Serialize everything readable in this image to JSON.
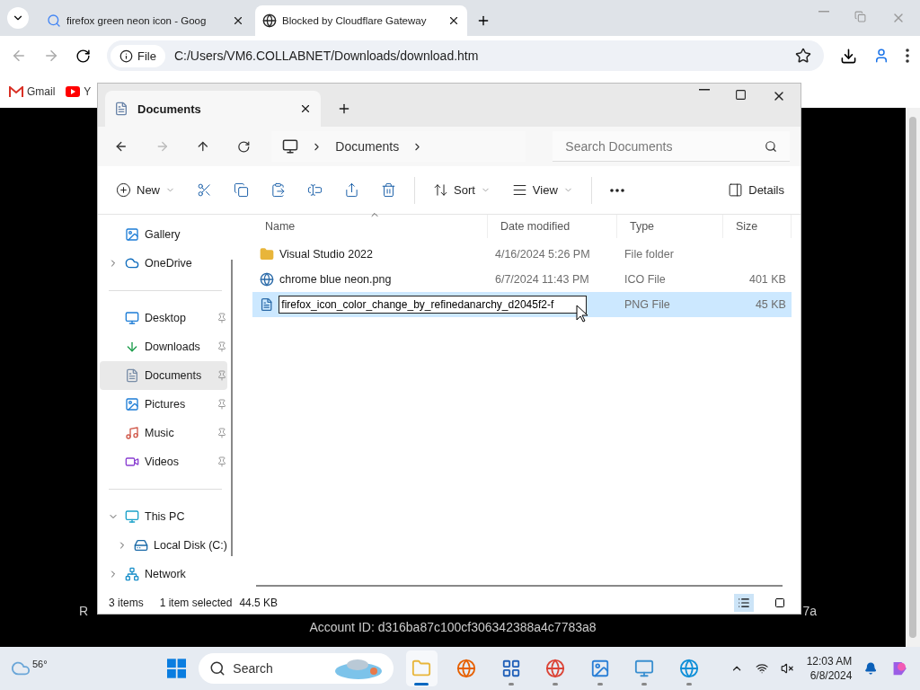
{
  "browser": {
    "tabs": [
      {
        "title": "firefox green neon icon - Goog",
        "selected": false
      },
      {
        "title": "Blocked by Cloudflare Gateway",
        "selected": true
      }
    ],
    "address": {
      "chip": "File",
      "url": "C:/Users/VM6.COLLABNET/Downloads/download.htm"
    },
    "bookmarks": [
      {
        "label": "Gmail"
      },
      {
        "label": "Y"
      }
    ]
  },
  "page": {
    "line_start": "R",
    "line_end": "7a",
    "account_id": "Account ID: d316ba87c100cf306342388a4c7783a8"
  },
  "explorer": {
    "tabs": [
      {
        "title": "Documents",
        "selected": true
      }
    ],
    "breadcrumb": [
      "Documents"
    ],
    "search": {
      "placeholder": "Search Documents"
    },
    "commands": [
      {
        "kind": "menu",
        "label": "New"
      },
      {
        "kind": "icon"
      },
      {
        "kind": "icon"
      },
      {
        "kind": "icon"
      },
      {
        "kind": "icon"
      },
      {
        "kind": "icon"
      },
      {
        "kind": "icon"
      },
      {
        "kind": "separator"
      },
      {
        "kind": "menu",
        "label": "Sort"
      },
      {
        "kind": "menu",
        "label": "View"
      },
      {
        "kind": "separator"
      },
      {
        "kind": "more"
      },
      {
        "kind": "spacer"
      },
      {
        "kind": "plain",
        "label": "Details"
      }
    ],
    "sidebar": [
      [
        {
          "label": "Gallery",
          "selected": false
        },
        {
          "label": "OneDrive",
          "selected": false,
          "expanded": false
        }
      ],
      [
        {
          "label": "Desktop",
          "selected": false,
          "pinned": true
        },
        {
          "label": "Downloads",
          "selected": false,
          "pinned": true
        },
        {
          "label": "Documents",
          "selected": true,
          "pinned": true
        },
        {
          "label": "Pictures",
          "selected": false,
          "pinned": true
        },
        {
          "label": "Music",
          "selected": false,
          "pinned": true
        },
        {
          "label": "Videos",
          "selected": false,
          "pinned": true
        }
      ],
      [
        {
          "label": "This PC",
          "selected": false,
          "expanded": true,
          "children": [
            {
              "label": "Local Disk (C:)",
              "selected": false,
              "expanded": false
            }
          ]
        },
        {
          "label": "Network",
          "selected": false,
          "expanded": false
        }
      ]
    ],
    "columns": [
      {
        "label": "Name",
        "sorted": true
      },
      {
        "label": "Date modified",
        "sorted": false
      },
      {
        "label": "Type",
        "sorted": false
      },
      {
        "label": "Size",
        "sorted": false
      }
    ],
    "rows": [
      {
        "name": "Visual Studio 2022",
        "date": "4/16/2024 5:26 PM",
        "type": "File folder",
        "selected": false,
        "editing": false
      },
      {
        "name": "chrome blue neon.png",
        "date": "6/7/2024 11:43 PM",
        "type": "ICO File",
        "size": "401 KB",
        "selected": false,
        "editing": false
      },
      {
        "name": "firefox_icon_color_change_by_refinedanarchy_d2045f2-f",
        "type": "PNG File",
        "size": "45 KB",
        "selected": true,
        "editing": true
      }
    ],
    "status": {
      "count": "3 items",
      "selection": "1 item selected",
      "size": "44.5 KB",
      "views": [
        {
          "selected": true
        },
        {
          "selected": false
        }
      ]
    }
  },
  "taskbar": {
    "weather": "56°",
    "search": "Search",
    "apps": [
      {
        "running": true,
        "active": true
      },
      {
        "running": false,
        "active": false
      },
      {
        "running": true,
        "active": false
      },
      {
        "running": true,
        "active": false
      },
      {
        "running": true,
        "active": false
      },
      {
        "running": true,
        "active": false
      },
      {
        "running": true,
        "active": false
      }
    ],
    "time": "12:03 AM",
    "date": "6/8/2024"
  }
}
